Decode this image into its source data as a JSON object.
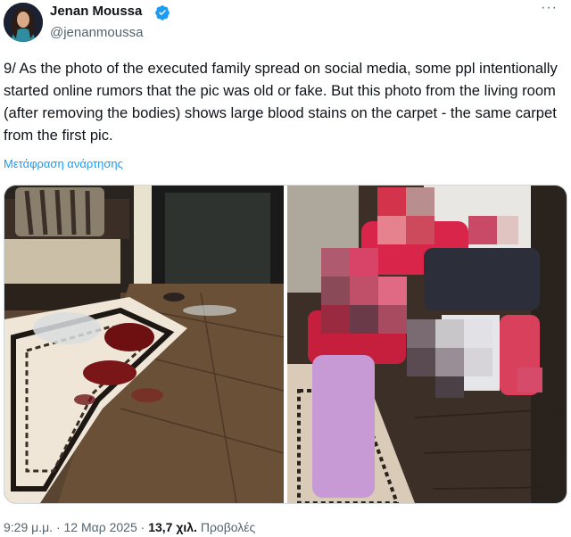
{
  "author": {
    "name": "Jenan Moussa",
    "handle": "@jenanmoussa",
    "verified": true
  },
  "icons": {
    "verified": "verified-badge-icon",
    "more": "more-options-icon"
  },
  "tweet": {
    "text": "9/ As the photo of the executed family spread on social media, some ppl intentionally started online rumors that the pic was old or fake. But this photo from the living room (after removing the bodies) shows large blood stains on the carpet - the same carpet from the first pic.",
    "translate_label": "Μετάφραση ανάρτησης"
  },
  "meta": {
    "time": "9:29 μ.μ.",
    "separator": "·",
    "date": "12 Μαρ 2025",
    "views_count": "13,7 χιλ.",
    "views_label": "Προβολές"
  },
  "colors": {
    "link": "#1d9bf0",
    "verified": "#1d9bf0",
    "secondary_text": "#536471"
  }
}
